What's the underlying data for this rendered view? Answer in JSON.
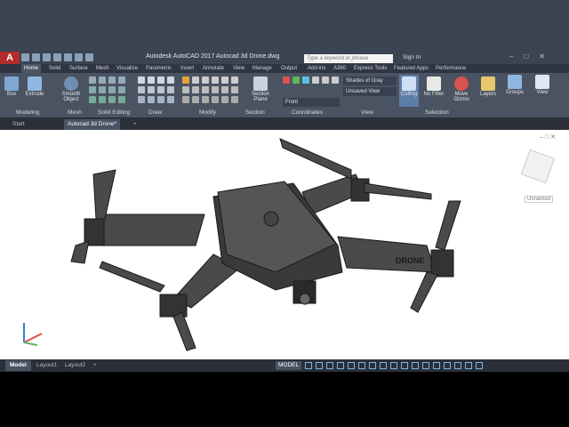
{
  "app": {
    "logo": "A",
    "title": "Autodesk AutoCAD 2017    Autocad 3d Drone.dwg",
    "search_placeholder": "Type a keyword or phrase",
    "signin": "Sign In"
  },
  "ribbon_tabs": [
    "Home",
    "Solid",
    "Surface",
    "Mesh",
    "Visualize",
    "Parametric",
    "Insert",
    "Annotate",
    "View",
    "Manage",
    "Output",
    "Add-ins",
    "A360",
    "Express Tools",
    "Featured Apps",
    "Performance"
  ],
  "ribbon": {
    "box": "Box",
    "extrude": "Extrude",
    "smooth_object": "Smooth Object",
    "section_plane": "Section Plane",
    "visual_style": "Shades of Gray",
    "view_saved": "Unsaved View",
    "view_dir": "Front",
    "culling": "Culling",
    "no_filter": "No Filter",
    "move_gizmo": "Move Gizmo",
    "layers": "Layers",
    "groups": "Groups",
    "view": "View",
    "panels": {
      "modeling": "Modeling",
      "mesh": "Mesh",
      "solid_editing": "Solid Editing",
      "draw": "Draw",
      "modify": "Modify",
      "section": "Section",
      "coordinates": "Coordinates",
      "view": "View",
      "selection": "Selection"
    }
  },
  "file_tabs": [
    "Start",
    "Autocad 3d Drone*"
  ],
  "viewport": {
    "unnamed": "Unnamed",
    "drone_label": "DRONE"
  },
  "layout_tabs": [
    "Model",
    "Layout1",
    "Layout2"
  ],
  "status": {
    "model": "MODEL"
  },
  "colors": {
    "ribbon": "#4a5362",
    "titlebar": "#3b4453",
    "logo": "#b52b2b",
    "viewport": "#ffffff",
    "drone": "#4a4a4a"
  }
}
